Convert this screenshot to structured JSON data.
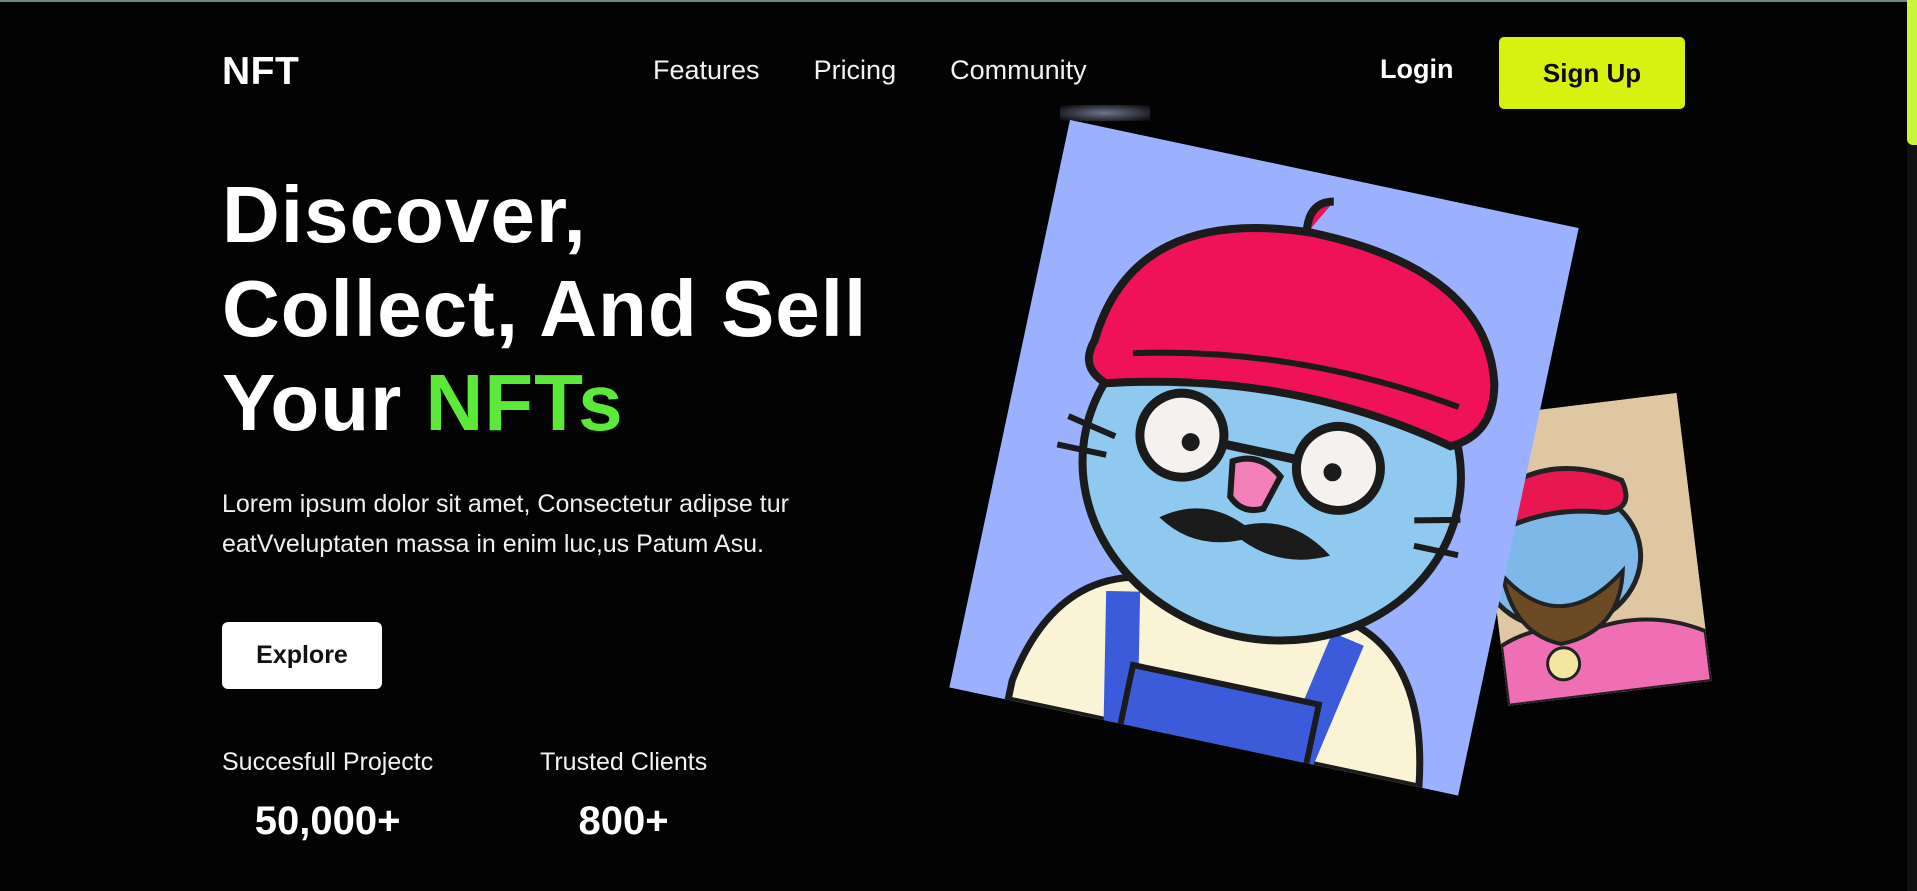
{
  "brand": {
    "logo": "NFT"
  },
  "nav": {
    "items": [
      "Features",
      "Pricing",
      "Community"
    ]
  },
  "auth": {
    "login": "Login",
    "signup": "Sign Up"
  },
  "hero": {
    "title_line1": "Discover,",
    "title_line2": "Collect, And Sell",
    "title_line3_plain": "Your ",
    "title_line3_highlight": "NFTs",
    "description": "Lorem ipsum dolor sit amet, Consectetur adipse tur eatVveluptaten massa in enim luc,us Patum Asu.",
    "cta": "Explore"
  },
  "stats": [
    {
      "label": "Succesfull Projectc",
      "value": "50,000+"
    },
    {
      "label": "Trusted Clients",
      "value": "800+"
    }
  ],
  "colors": {
    "accent": "#d7f20f",
    "highlight": "#5bea3a",
    "background": "#030303"
  },
  "images": [
    "cat-beret-glasses-nft",
    "cat-beret-beard-nft"
  ]
}
